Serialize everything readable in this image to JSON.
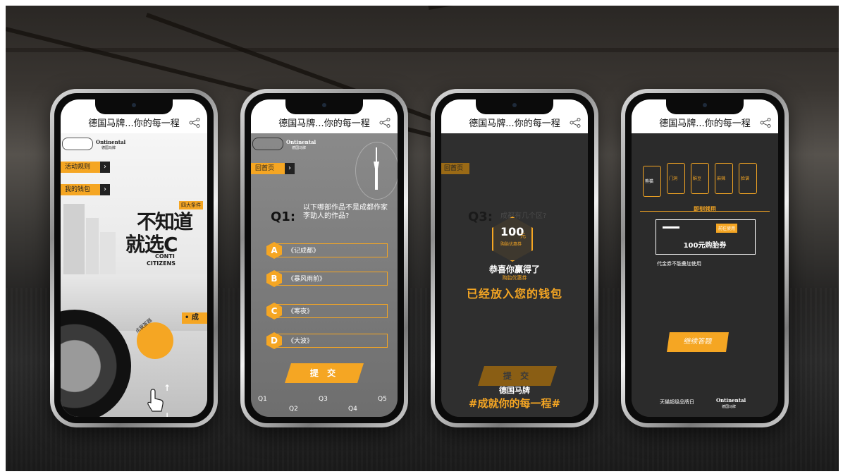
{
  "phones": [
    {
      "title": "德国马牌...你的每一程",
      "brand_logo": "Ontinental",
      "brand_sub": "德国马牌",
      "menu": [
        "活动规则",
        "我的钱包"
      ],
      "badge": "四大条件",
      "headline_line1": "不知道",
      "headline_line2": "就选C",
      "conti_line1": "CONTI",
      "conti_line2": "CITIZENS",
      "side_tag": "• 成",
      "dial_label": "点我答题"
    },
    {
      "title": "德国马牌...你的每一程",
      "brand_logo": "Ontinental",
      "brand_sub": "德国马牌",
      "home_button": "回首页",
      "q_number": "Q1:",
      "question": "以下哪部作品不是成都作家李劼人的作品?",
      "options": [
        {
          "letter": "A",
          "text": "《记成都》"
        },
        {
          "letter": "B",
          "text": "《暴风雨前》"
        },
        {
          "letter": "C",
          "text": "《寒夜》"
        },
        {
          "letter": "D",
          "text": "《大波》"
        }
      ],
      "submit": "提 交",
      "progress": [
        "Q1",
        "Q2",
        "Q3",
        "Q4",
        "Q5"
      ]
    },
    {
      "title": "德国马牌...你的每一程",
      "home_button": "回首页",
      "q_number": "Q3:",
      "question": "成都有几个区?",
      "coupon_amount": "100",
      "coupon_unit": "元",
      "coupon_label": "购胎优惠券",
      "win_text": "恭喜你赢得了",
      "win_sub": "购胎优惠券",
      "wallet_text": "已经放入您的钱包",
      "submit": "提 交",
      "brand_cn": "德国马牌",
      "slogan": "#成就你的每一程#"
    },
    {
      "title": "德国马牌...你的每一程",
      "cards": [
        "熊猫",
        "门洞",
        "酥豆",
        "麻辣",
        "脸谱"
      ],
      "section_title": "即刻领用",
      "voucher_amount": "100元购胎券",
      "voucher_btn": "前往使用",
      "voucher_note": "代金券不能叠加使用",
      "continue_btn": "继续答题",
      "footer_logo1": "天猫超级品牌日",
      "footer_logo2": "Ontinental",
      "footer_logo2_sub": "德国马牌"
    }
  ],
  "colors": {
    "accent": "#f5a623",
    "titlebar": "#ffffff",
    "dark": "#2f2f2f"
  },
  "icons": [
    "share-icon",
    "arrow-right-icon",
    "tower-icon",
    "swipe-hand-icon"
  ]
}
